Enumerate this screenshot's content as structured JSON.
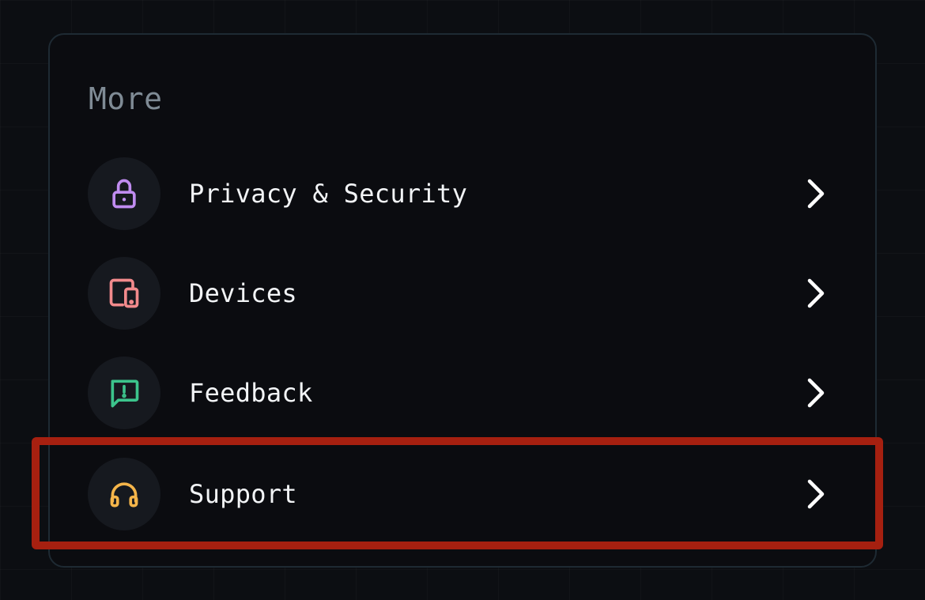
{
  "section": {
    "title": "More"
  },
  "items": [
    {
      "id": "privacy",
      "label": "Privacy & Security",
      "icon": "lock-icon",
      "color": "#c08cf0"
    },
    {
      "id": "devices",
      "label": "Devices",
      "icon": "devices-icon",
      "color": "#f28a8c"
    },
    {
      "id": "feedback",
      "label": "Feedback",
      "icon": "feedback-icon",
      "color": "#3cc48c"
    },
    {
      "id": "support",
      "label": "Support",
      "icon": "headphones-icon",
      "color": "#f5b54a"
    }
  ],
  "chevron_icon": "chevron-right-icon",
  "highlight": {
    "target": "Support",
    "color": "#a62010"
  }
}
